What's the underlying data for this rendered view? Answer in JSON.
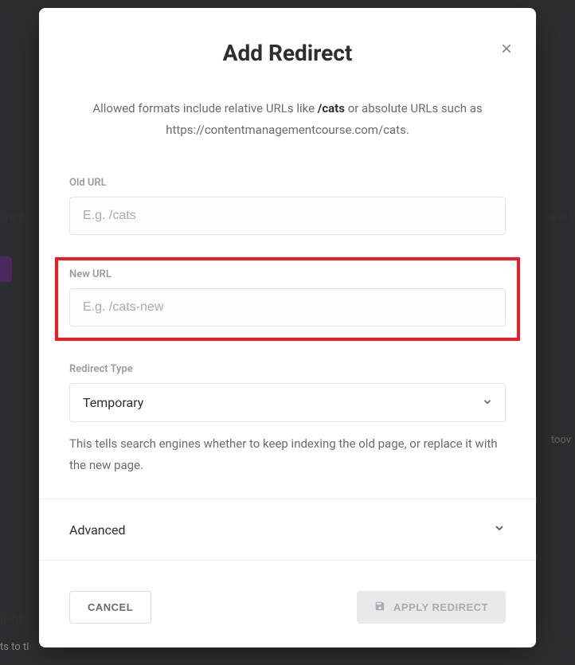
{
  "modal": {
    "title": "Add Redirect",
    "description_prefix": "Allowed formats include relative URLs like ",
    "description_bold": "/cats",
    "description_middle": " or absolute URLs such as ",
    "description_url": "https://contentmanagementcourse.com/cats",
    "description_suffix": ".",
    "close_label": "×"
  },
  "fields": {
    "old_url": {
      "label": "Old URL",
      "placeholder": "E.g. /cats",
      "value": ""
    },
    "new_url": {
      "label": "New URL",
      "placeholder": "E.g. /cats-new",
      "value": ""
    },
    "redirect_type": {
      "label": "Redirect Type",
      "selected": "Temporary",
      "help": "This tells search engines whether to keep indexing the old page, or replace it with the new page."
    }
  },
  "advanced": {
    "label": "Advanced"
  },
  "footer": {
    "cancel": "CANCEL",
    "apply": "APPLY REDIRECT"
  },
  "backdrop": {
    "left_text": "lirect I",
    "right_text": "end v",
    "bottom1": "nents",
    "bottom2": "ts to tl",
    "hoov": "toov"
  }
}
